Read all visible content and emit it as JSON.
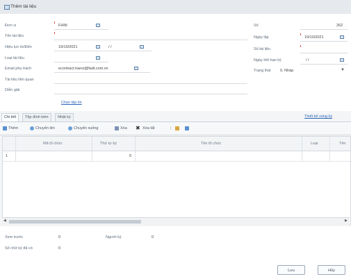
{
  "window": {
    "title": "Thêm tài liệu"
  },
  "form": {
    "don_vi_label": "Đơn vị",
    "don_vi_value": "FHNI",
    "ten_tai_lieu_label": "Tên tài liệu",
    "hieu_luc_label": "Hiệu lực từ/Đến",
    "hieu_luc_from": "19/10/2021",
    "hieu_luc_to": "/ /",
    "loai_tai_lieu_label": "Loại tài liệu",
    "email_label": "Email phụ trách",
    "email_value": "econtract.hanoi@fadt.com.vn",
    "tai_lieu_lien_quan_label": "Tài liệu liên quan",
    "dien_giai_label": "Diễn giải",
    "chon_tep_link": "Chọn tệp tin",
    "so_label": "Số",
    "so_value": "262",
    "ngay_lap_label": "Ngày lập",
    "ngay_lap_value": "19/10/2021",
    "so_tai_lieu_label": "Số tài liệu",
    "ngay_het_han_label": "Ngày hết hạn ký",
    "ngay_het_han_value": "/ /",
    "trang_thai_label": "Trạng thái",
    "trang_thai_value": "0. Nháp"
  },
  "tabs": [
    {
      "label": "Chi tiết"
    },
    {
      "label": "Tệp đính kèm"
    },
    {
      "label": "Nhật ký"
    }
  ],
  "tabs_link": "Thiết kế vùng ký",
  "toolbar": {
    "them": "Thêm",
    "chuyen_len": "Chuyển lên",
    "chuyen_xuong": "Chuyển xuống",
    "xoa": "Xóa",
    "xoa_tat": "Xóa tất"
  },
  "grid": {
    "columns": [
      "Mã tổ chức",
      "Thứ tự ký",
      "Tên tổ chức",
      "Loại",
      "Tên"
    ],
    "rows": [
      {
        "index": "1",
        "thu_tu": "0"
      }
    ]
  },
  "footer": {
    "xem_truoc_label": "Xem trước",
    "xem_truoc_value": "0",
    "nguoi_ky_label": "Người ký",
    "nguoi_ky_value": "0",
    "so_chu_ky_label": "Số chữ ký đã có",
    "so_chu_ky_value": "0"
  },
  "buttons": {
    "luu": "Lưu",
    "huy": "Hủy"
  }
}
